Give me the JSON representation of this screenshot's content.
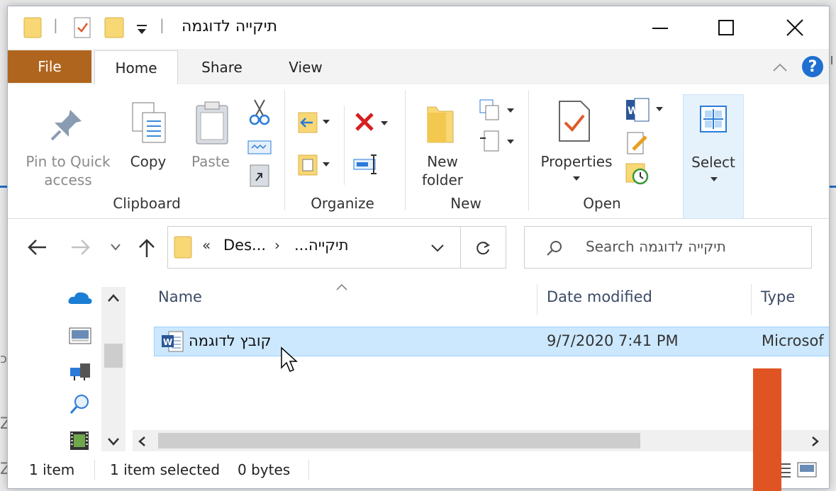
{
  "window": {
    "title": "תיקייה לדוגמה",
    "qat_separator": "|",
    "qat_dropdown_icon": "customize-qat-icon"
  },
  "menu": {
    "file": "File",
    "tabs": [
      "Home",
      "Share",
      "View"
    ],
    "active_tab": "Home"
  },
  "ribbon": {
    "clipboard": {
      "group_label": "Clipboard",
      "pin_label_1": "Pin to Quick",
      "pin_label_2": "access",
      "copy_label": "Copy",
      "paste_label": "Paste"
    },
    "organize": {
      "group_label": "Organize"
    },
    "new": {
      "group_label": "New",
      "new_folder_1": "New",
      "new_folder_2": "folder"
    },
    "open": {
      "group_label": "Open",
      "properties_label": "Properties"
    },
    "select": {
      "label": "Select"
    }
  },
  "nav": {
    "breadcrumb_overflow": "«",
    "crumb_1": "Des...",
    "crumb_sep": "›",
    "crumb_2": "...תיקייה",
    "search_placeholder": "Search תיקייה לדוגמה"
  },
  "columns": {
    "name": "Name",
    "date": "Date modified",
    "type": "Type"
  },
  "files": [
    {
      "name": "קובץ לדוגמה",
      "date": "9/7/2020 7:41 PM",
      "type": "Microsof",
      "icon": "word-document-icon"
    }
  ],
  "status": {
    "count": "1 item",
    "selected": "1 item selected",
    "size": "0 bytes"
  },
  "colors": {
    "file_tab": "#b0651e",
    "selection": "#cce8ff",
    "help": "#1f6fd1",
    "overlay": "#e05424"
  }
}
